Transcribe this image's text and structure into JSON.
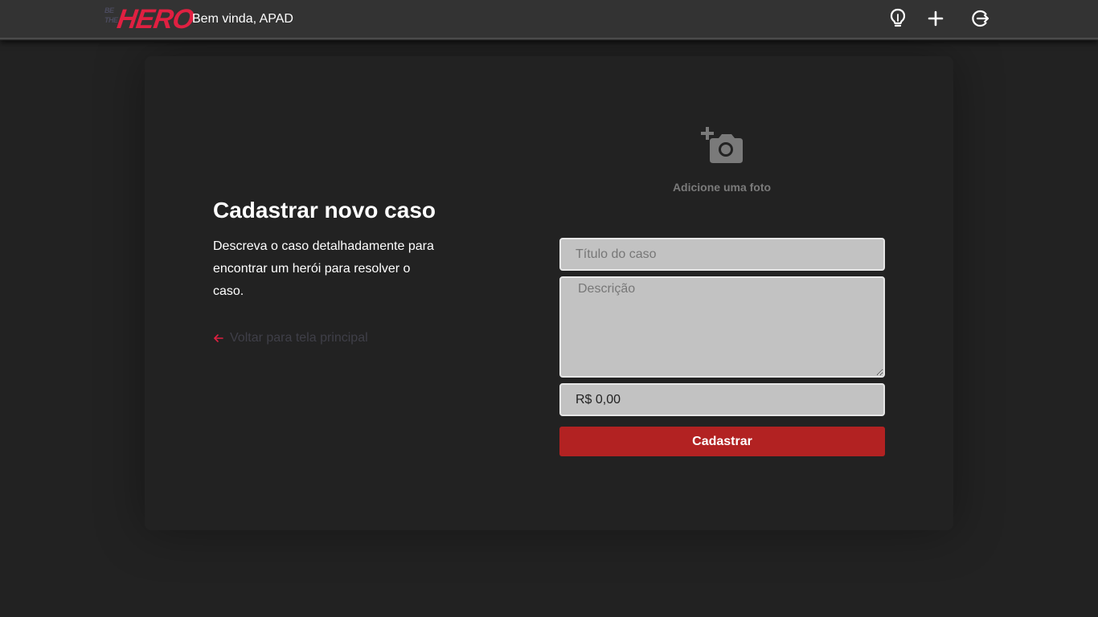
{
  "header": {
    "logo_small_top": "BE",
    "logo_small_bottom": "THE",
    "logo_big": "HERO",
    "welcome": "Bem vinda, APAD",
    "icons": [
      "lightbulb-icon",
      "plus-icon",
      "logout-icon"
    ]
  },
  "main": {
    "title": "Cadastrar novo caso",
    "description": "Descreva o caso detalhadamente para encontrar um herói para resolver o caso.",
    "back_link": "Voltar para tela principal",
    "photo_label": "Adicione uma foto"
  },
  "form": {
    "title_placeholder": "Título do caso",
    "description_placeholder": "Descrição",
    "value": "R$ 0,00",
    "submit_label": "Cadastrar"
  },
  "colors": {
    "accent": "#e02041",
    "button": "#b22222",
    "background": "#222222",
    "header": "#333333"
  }
}
